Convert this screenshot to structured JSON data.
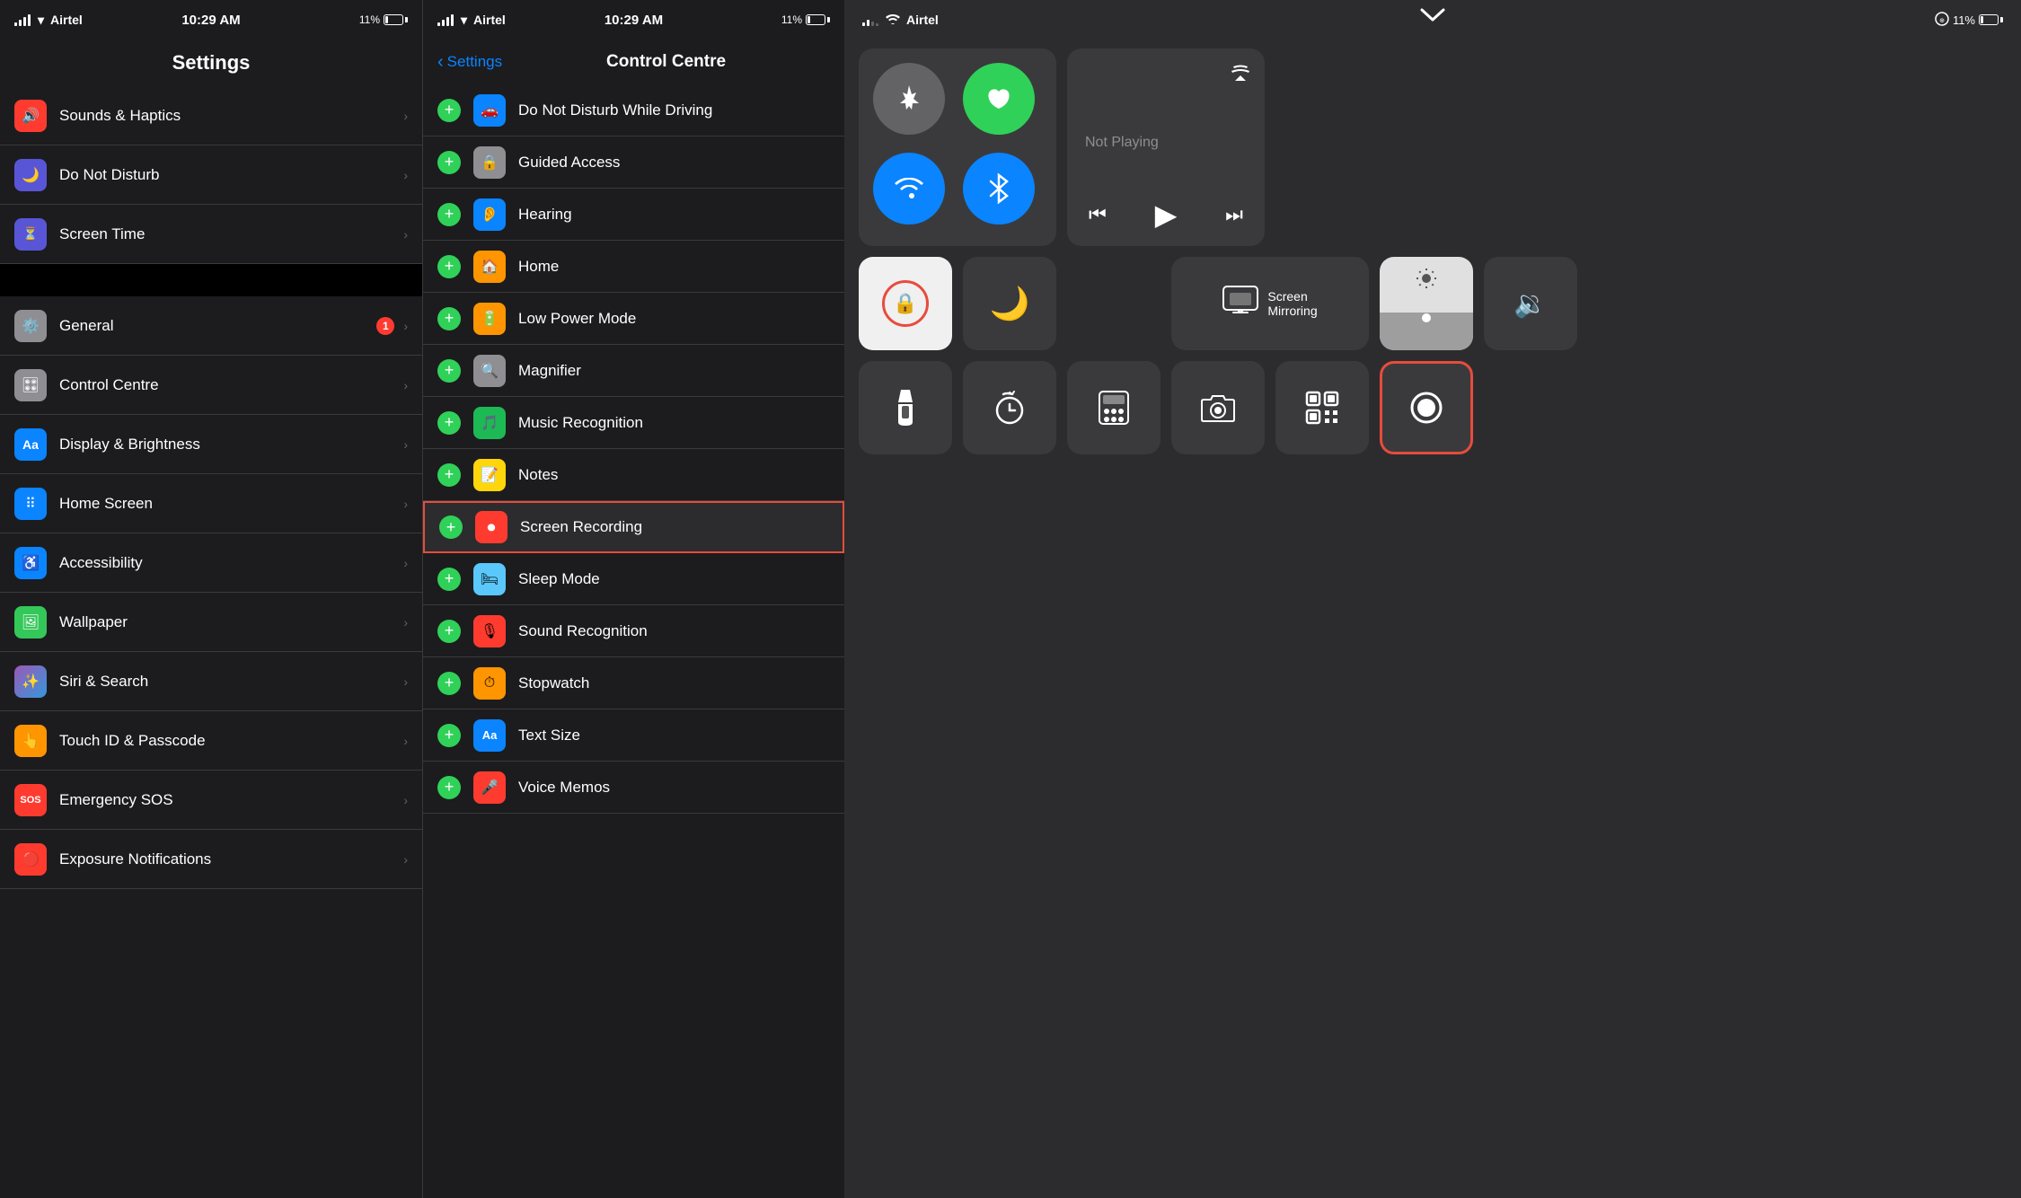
{
  "panel1": {
    "title": "Settings",
    "statusBar": {
      "carrier": "Airtel",
      "time": "10:29 AM",
      "battery": "11%"
    },
    "items": [
      {
        "id": "sounds",
        "label": "Sounds & Haptics",
        "iconBg": "#ff3b30",
        "iconColor": "#fff",
        "iconSymbol": "🔊",
        "badge": null
      },
      {
        "id": "donotdisturb",
        "label": "Do Not Disturb",
        "iconBg": "#5856d6",
        "iconColor": "#fff",
        "iconSymbol": "🌙",
        "badge": null
      },
      {
        "id": "screentime",
        "label": "Screen Time",
        "iconBg": "#5856d6",
        "iconColor": "#fff",
        "iconSymbol": "⏳",
        "badge": null
      },
      {
        "id": "general",
        "label": "General",
        "iconBg": "#8e8e93",
        "iconColor": "#fff",
        "iconSymbol": "⚙️",
        "badge": "1"
      },
      {
        "id": "controlcentre",
        "label": "Control Centre",
        "iconBg": "#8e8e93",
        "iconColor": "#fff",
        "iconSymbol": "🎛",
        "badge": null
      },
      {
        "id": "displaybrightness",
        "label": "Display & Brightness",
        "iconBg": "#0a84ff",
        "iconColor": "#fff",
        "iconSymbol": "Aa",
        "badge": null
      },
      {
        "id": "homescreen",
        "label": "Home Screen",
        "iconBg": "#0a84ff",
        "iconColor": "#fff",
        "iconSymbol": "⠿",
        "badge": null
      },
      {
        "id": "accessibility",
        "label": "Accessibility",
        "iconBg": "#0a84ff",
        "iconColor": "#fff",
        "iconSymbol": "♿",
        "badge": null
      },
      {
        "id": "wallpaper",
        "label": "Wallpaper",
        "iconBg": "#34c759",
        "iconColor": "#fff",
        "iconSymbol": "🖼",
        "badge": null
      },
      {
        "id": "sirisearch",
        "label": "Siri & Search",
        "iconBg": "#9b59b6",
        "iconColor": "#fff",
        "iconSymbol": "✨",
        "badge": null
      },
      {
        "id": "touchid",
        "label": "Touch ID & Passcode",
        "iconBg": "#ff9500",
        "iconColor": "#fff",
        "iconSymbol": "👆",
        "badge": null
      },
      {
        "id": "emergencysos",
        "label": "Emergency SOS",
        "iconBg": "#ff3b30",
        "iconColor": "#fff",
        "iconSymbol": "SOS",
        "badge": null
      },
      {
        "id": "exposurenotifications",
        "label": "Exposure Notifications",
        "iconBg": "#ff3b30",
        "iconColor": "#fff",
        "iconSymbol": "🔴",
        "badge": null
      }
    ]
  },
  "panel2": {
    "title": "Control Centre",
    "backLabel": "Settings",
    "statusBar": {
      "carrier": "Airtel",
      "time": "10:29 AM",
      "battery": "11%"
    },
    "items": [
      {
        "id": "donotdisturbdriving",
        "label": "Do Not Disturb While Driving",
        "iconBg": "#0a84ff",
        "iconSymbol": "🚗",
        "highlighted": false
      },
      {
        "id": "guidedaccess",
        "label": "Guided Access",
        "iconBg": "#8e8e93",
        "iconSymbol": "🔒",
        "highlighted": false
      },
      {
        "id": "hearing",
        "label": "Hearing",
        "iconBg": "#0a84ff",
        "iconSymbol": "👂",
        "highlighted": false
      },
      {
        "id": "home",
        "label": "Home",
        "iconBg": "#ff9500",
        "iconSymbol": "🏠",
        "highlighted": false
      },
      {
        "id": "lowpowermode",
        "label": "Low Power Mode",
        "iconBg": "#ff9500",
        "iconSymbol": "🔋",
        "highlighted": false
      },
      {
        "id": "magnifier",
        "label": "Magnifier",
        "iconBg": "#8e8e93",
        "iconSymbol": "🔍",
        "highlighted": false
      },
      {
        "id": "musicrecognition",
        "label": "Music Recognition",
        "iconBg": "#1db954",
        "iconSymbol": "🎵",
        "highlighted": false
      },
      {
        "id": "notes",
        "label": "Notes",
        "iconBg": "#ffd60a",
        "iconSymbol": "📝",
        "highlighted": false
      },
      {
        "id": "screenrecording",
        "label": "Screen Recording",
        "iconBg": "#ff3b30",
        "iconSymbol": "⏺",
        "highlighted": true
      },
      {
        "id": "sleepmode",
        "label": "Sleep Mode",
        "iconBg": "#5ac8fa",
        "iconSymbol": "🛏",
        "highlighted": false
      },
      {
        "id": "soundrecognition",
        "label": "Sound Recognition",
        "iconBg": "#ff3b30",
        "iconSymbol": "🎙",
        "highlighted": false
      },
      {
        "id": "stopwatch",
        "label": "Stopwatch",
        "iconBg": "#ff9500",
        "iconSymbol": "⏱",
        "highlighted": false
      },
      {
        "id": "textsize",
        "label": "Text Size",
        "iconBg": "#0a84ff",
        "iconSymbol": "Aa",
        "highlighted": false
      },
      {
        "id": "voicememos",
        "label": "Voice Memos",
        "iconBg": "#ff3b30",
        "iconSymbol": "🎤",
        "highlighted": false
      }
    ]
  },
  "panel3": {
    "statusBar": {
      "carrier": "Airtel",
      "battery": "11%"
    },
    "nowPlaying": {
      "title": "Not Playing"
    },
    "mirroring": {
      "label": "Screen\nMirroring"
    }
  }
}
